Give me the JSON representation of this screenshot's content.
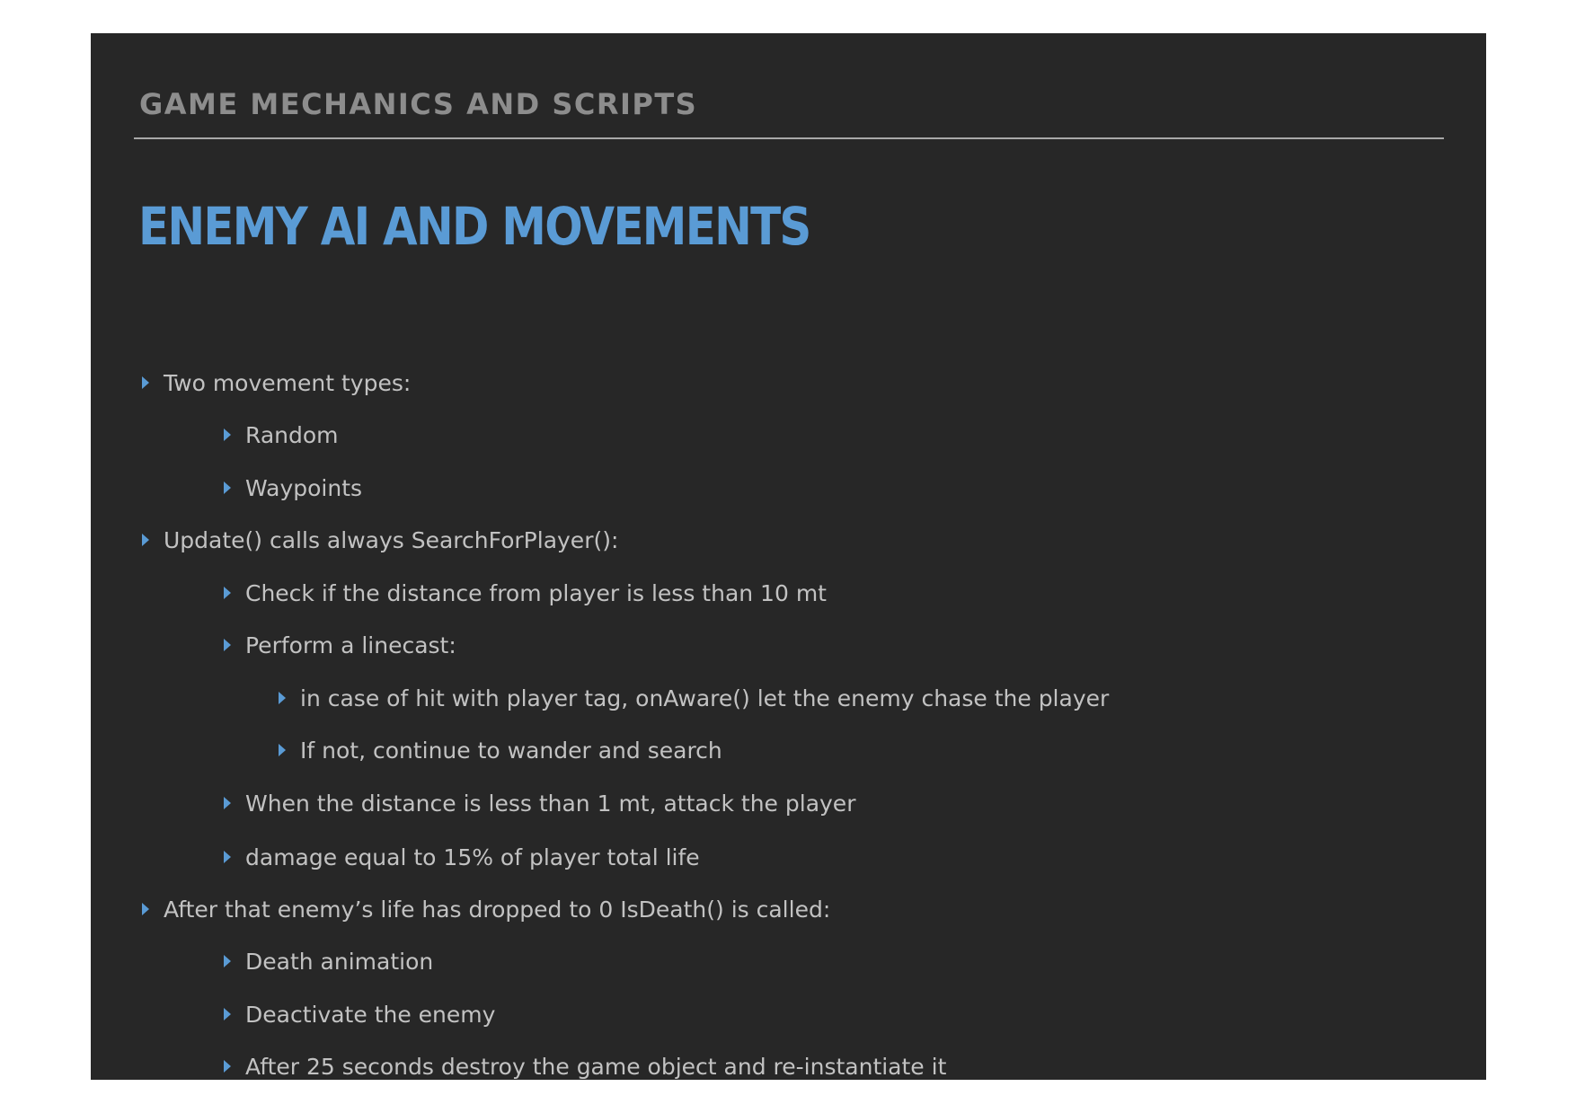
{
  "header": {
    "section_title": "GAME MECHANICS AND SCRIPTS",
    "slide_title": "ENEMY AI AND MOVEMENTS"
  },
  "colors": {
    "accent": "#5a9bd5",
    "background": "#272727",
    "body_text": "#c2c2c2",
    "section_title": "#8d8d8d"
  },
  "bullets": [
    {
      "level": 1,
      "text": "Two movement types:"
    },
    {
      "level": 2,
      "text": "Random"
    },
    {
      "level": 2,
      "text": "Waypoints"
    },
    {
      "level": 1,
      "text": "Update() calls always SearchForPlayer():"
    },
    {
      "level": 2,
      "text": "Check if the distance from player is less than 10 mt"
    },
    {
      "level": 2,
      "text": "Perform a linecast:"
    },
    {
      "level": 3,
      "text": " in case of hit with player tag, onAware() let the enemy chase the player"
    },
    {
      "level": 3,
      "text": "If not,  continue to wander and search"
    },
    {
      "level": 2,
      "text": "When the distance is less than 1 mt, attack the player"
    },
    {
      "level": 2,
      "text": "damage equal to 15% of player total life"
    },
    {
      "level": 1,
      "text": "After that enemy’s life has dropped to 0 IsDeath() is called:"
    },
    {
      "level": 2,
      "text": "Death animation"
    },
    {
      "level": 2,
      "text": " Deactivate the enemy"
    },
    {
      "level": 2,
      "text": "After 25 seconds destroy the game object and re-instantiate it"
    }
  ]
}
